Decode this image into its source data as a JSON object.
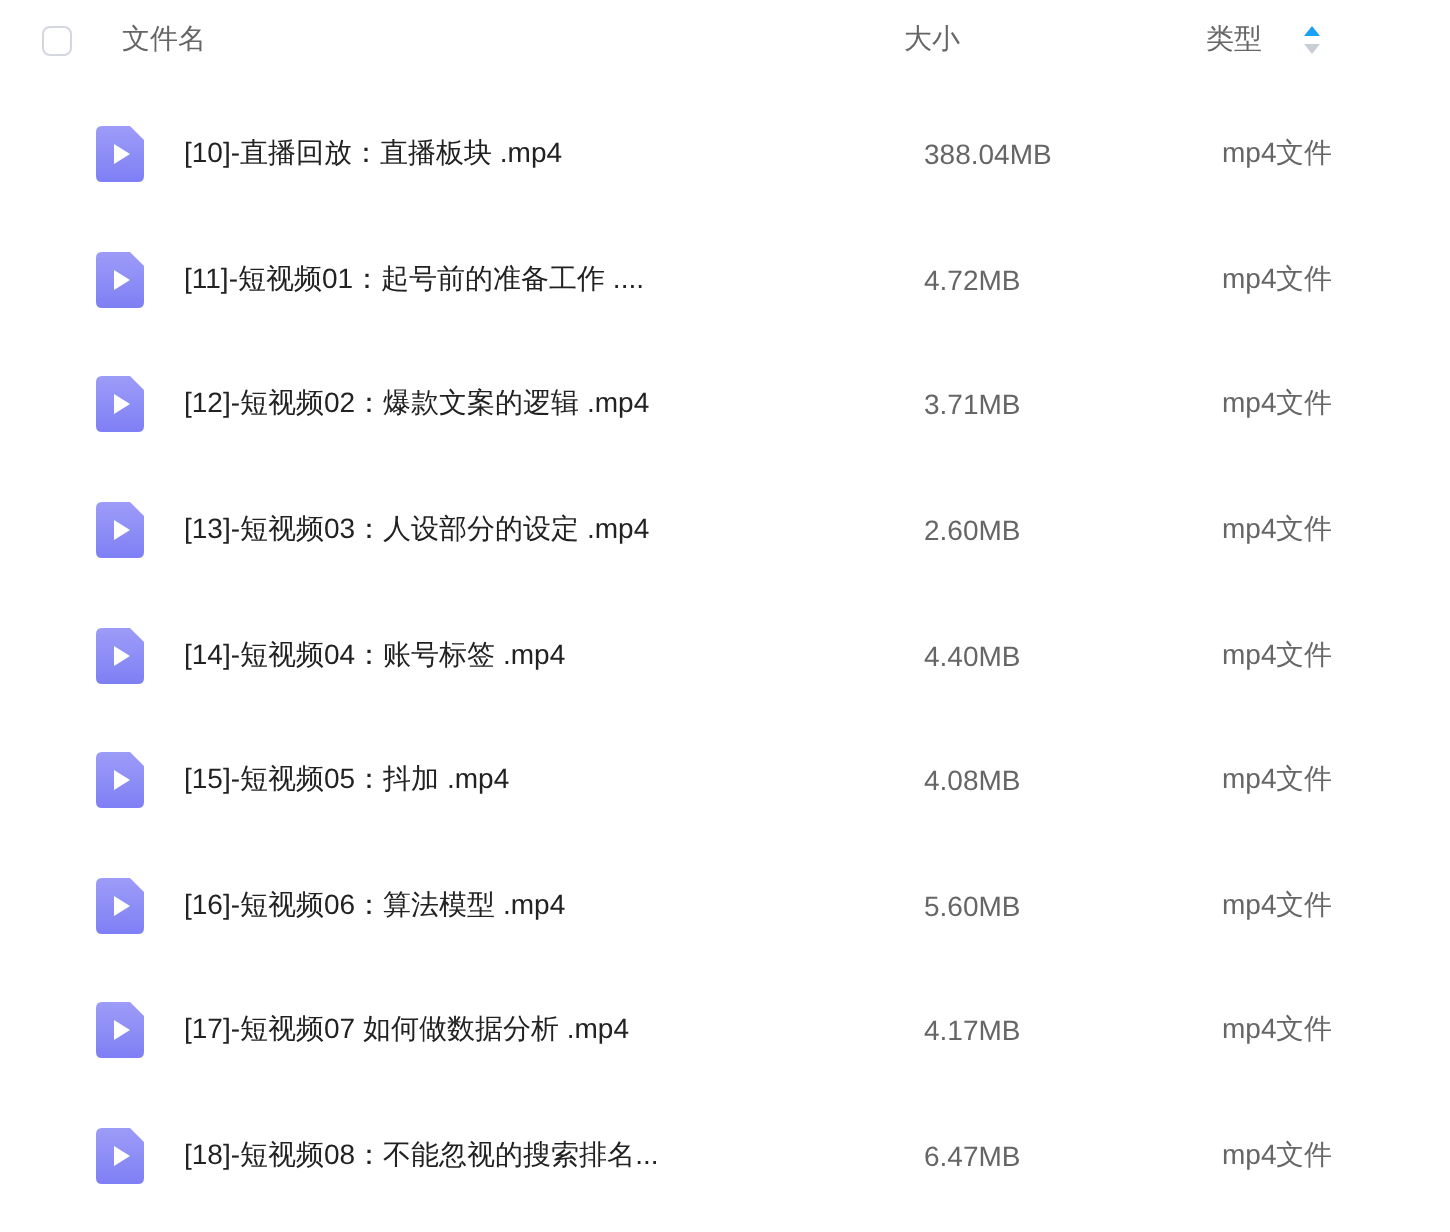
{
  "header": {
    "select_all": {
      "checked": false
    },
    "columns": [
      {
        "label": "文件名",
        "sorted": false
      },
      {
        "label": "大小",
        "sorted": false
      },
      {
        "label": "类型",
        "sorted": true
      }
    ]
  },
  "files": [
    {
      "name": "[10]-直播回放：直播板块 .mp4",
      "size": "388.04MB",
      "type": "mp4文件"
    },
    {
      "name": "[11]-短视频01：起号前的准备工作 ....",
      "size": "4.72MB",
      "type": "mp4文件"
    },
    {
      "name": "[12]-短视频02：爆款文案的逻辑 .mp4",
      "size": "3.71MB",
      "type": "mp4文件"
    },
    {
      "name": "[13]-短视频03：人设部分的设定 .mp4",
      "size": "2.60MB",
      "type": "mp4文件"
    },
    {
      "name": "[14]-短视频04：账号标签 .mp4",
      "size": "4.40MB",
      "type": "mp4文件"
    },
    {
      "name": "[15]-短视频05：抖加 .mp4",
      "size": "4.08MB",
      "type": "mp4文件"
    },
    {
      "name": "[16]-短视频06：算法模型 .mp4",
      "size": "5.60MB",
      "type": "mp4文件"
    },
    {
      "name": "[17]-短视频07 如何做数据分析 .mp4",
      "size": "4.17MB",
      "type": "mp4文件"
    },
    {
      "name": "[18]-短视频08：不能忽视的搜索排名...",
      "size": "6.47MB",
      "type": "mp4文件"
    }
  ]
}
